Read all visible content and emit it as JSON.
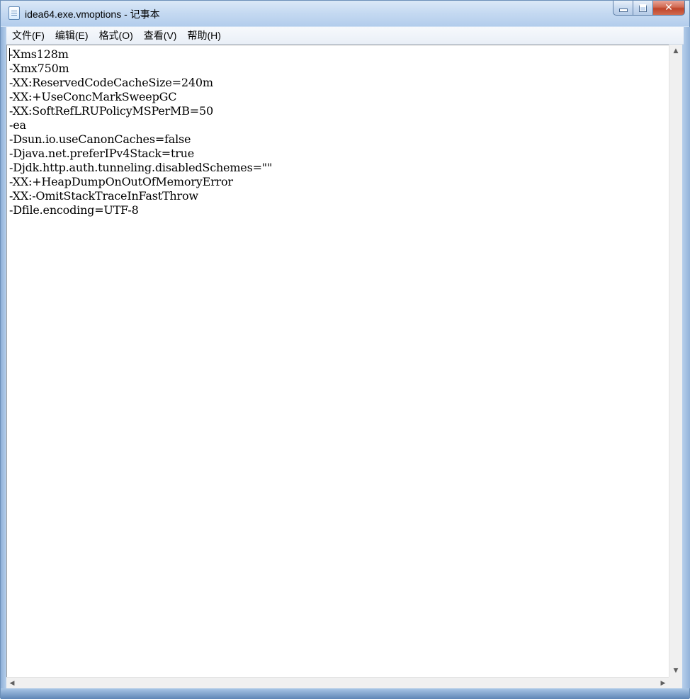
{
  "window": {
    "title": "idea64.exe.vmoptions - 记事本",
    "icon": "notepad-icon",
    "controls": {
      "minimize": "minimize-icon",
      "maximize": "maximize-icon",
      "close": "close-icon"
    }
  },
  "menu": {
    "items": [
      {
        "label": "文件(F)"
      },
      {
        "label": "编辑(E)"
      },
      {
        "label": "格式(O)"
      },
      {
        "label": "查看(V)"
      },
      {
        "label": "帮助(H)"
      }
    ]
  },
  "editor": {
    "lines": [
      "-Xms128m",
      "-Xmx750m",
      "-XX:ReservedCodeCacheSize=240m",
      "-XX:+UseConcMarkSweepGC",
      "-XX:SoftRefLRUPolicyMSPerMB=50",
      "-ea",
      "-Dsun.io.useCanonCaches=false",
      "-Djava.net.preferIPv4Stack=true",
      "-Djdk.http.auth.tunneling.disabledSchemes=\"\"",
      "-XX:+HeapDumpOnOutOfMemoryError",
      "-XX:-OmitStackTraceInFastThrow",
      "-Dfile.encoding=UTF-8"
    ]
  },
  "scrollbars": {
    "up": "▲",
    "down": "▼",
    "left": "◀",
    "right": "▶"
  }
}
